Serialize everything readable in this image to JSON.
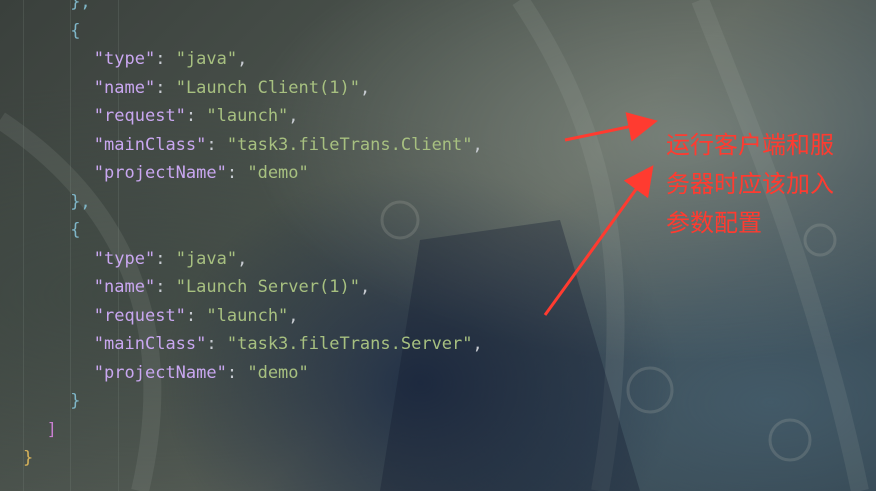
{
  "editor": {
    "lines": [
      {
        "indent": 4,
        "parts": [
          {
            "t": "},",
            "c": "brace"
          }
        ]
      },
      {
        "indent": 4,
        "parts": [
          {
            "t": "{",
            "c": "brace"
          }
        ]
      },
      {
        "indent": 6,
        "parts": [
          {
            "t": "\"type\"",
            "c": "key"
          },
          {
            "t": ": ",
            "c": "punc"
          },
          {
            "t": "\"java\"",
            "c": "str"
          },
          {
            "t": ",",
            "c": "punc"
          }
        ]
      },
      {
        "indent": 6,
        "parts": [
          {
            "t": "\"name\"",
            "c": "key"
          },
          {
            "t": ": ",
            "c": "punc"
          },
          {
            "t": "\"Launch Client(1)\"",
            "c": "str"
          },
          {
            "t": ",",
            "c": "punc"
          }
        ]
      },
      {
        "indent": 6,
        "parts": [
          {
            "t": "\"request\"",
            "c": "key"
          },
          {
            "t": ": ",
            "c": "punc"
          },
          {
            "t": "\"launch\"",
            "c": "str"
          },
          {
            "t": ",",
            "c": "punc"
          }
        ]
      },
      {
        "indent": 6,
        "parts": [
          {
            "t": "\"mainClass\"",
            "c": "key"
          },
          {
            "t": ": ",
            "c": "punc"
          },
          {
            "t": "\"task3.fileTrans.Client\"",
            "c": "str"
          },
          {
            "t": ",",
            "c": "punc"
          }
        ]
      },
      {
        "indent": 6,
        "parts": [
          {
            "t": "\"projectName\"",
            "c": "key"
          },
          {
            "t": ": ",
            "c": "punc"
          },
          {
            "t": "\"demo\"",
            "c": "str"
          }
        ]
      },
      {
        "indent": 4,
        "parts": [
          {
            "t": "},",
            "c": "brace"
          }
        ]
      },
      {
        "indent": 4,
        "parts": [
          {
            "t": "{",
            "c": "brace"
          }
        ]
      },
      {
        "indent": 6,
        "parts": [
          {
            "t": "\"type\"",
            "c": "key"
          },
          {
            "t": ": ",
            "c": "punc"
          },
          {
            "t": "\"java\"",
            "c": "str"
          },
          {
            "t": ",",
            "c": "punc"
          }
        ]
      },
      {
        "indent": 6,
        "parts": [
          {
            "t": "\"name\"",
            "c": "key"
          },
          {
            "t": ": ",
            "c": "punc"
          },
          {
            "t": "\"Launch Server(1)\"",
            "c": "str"
          },
          {
            "t": ",",
            "c": "punc"
          }
        ]
      },
      {
        "indent": 6,
        "parts": [
          {
            "t": "\"request\"",
            "c": "key"
          },
          {
            "t": ": ",
            "c": "punc"
          },
          {
            "t": "\"launch\"",
            "c": "str"
          },
          {
            "t": ",",
            "c": "punc"
          }
        ]
      },
      {
        "indent": 6,
        "parts": [
          {
            "t": "\"mainClass\"",
            "c": "key"
          },
          {
            "t": ": ",
            "c": "punc"
          },
          {
            "t": "\"task3.fileTrans.Server\"",
            "c": "str"
          },
          {
            "t": ",",
            "c": "punc"
          }
        ]
      },
      {
        "indent": 6,
        "parts": [
          {
            "t": "\"projectName\"",
            "c": "key"
          },
          {
            "t": ": ",
            "c": "punc"
          },
          {
            "t": "\"demo\"",
            "c": "str"
          }
        ]
      },
      {
        "indent": 4,
        "parts": [
          {
            "t": "}",
            "c": "brace"
          }
        ]
      },
      {
        "indent": 2,
        "parts": [
          {
            "t": "]",
            "c": "brack"
          }
        ]
      },
      {
        "indent": 0,
        "parts": [
          {
            "t": "}",
            "c": "outer-brace"
          }
        ]
      }
    ]
  },
  "annotation": {
    "lines": [
      "运行客户端和服",
      "务器时应该加入",
      "参数配置"
    ],
    "color": "#ff3b30"
  }
}
